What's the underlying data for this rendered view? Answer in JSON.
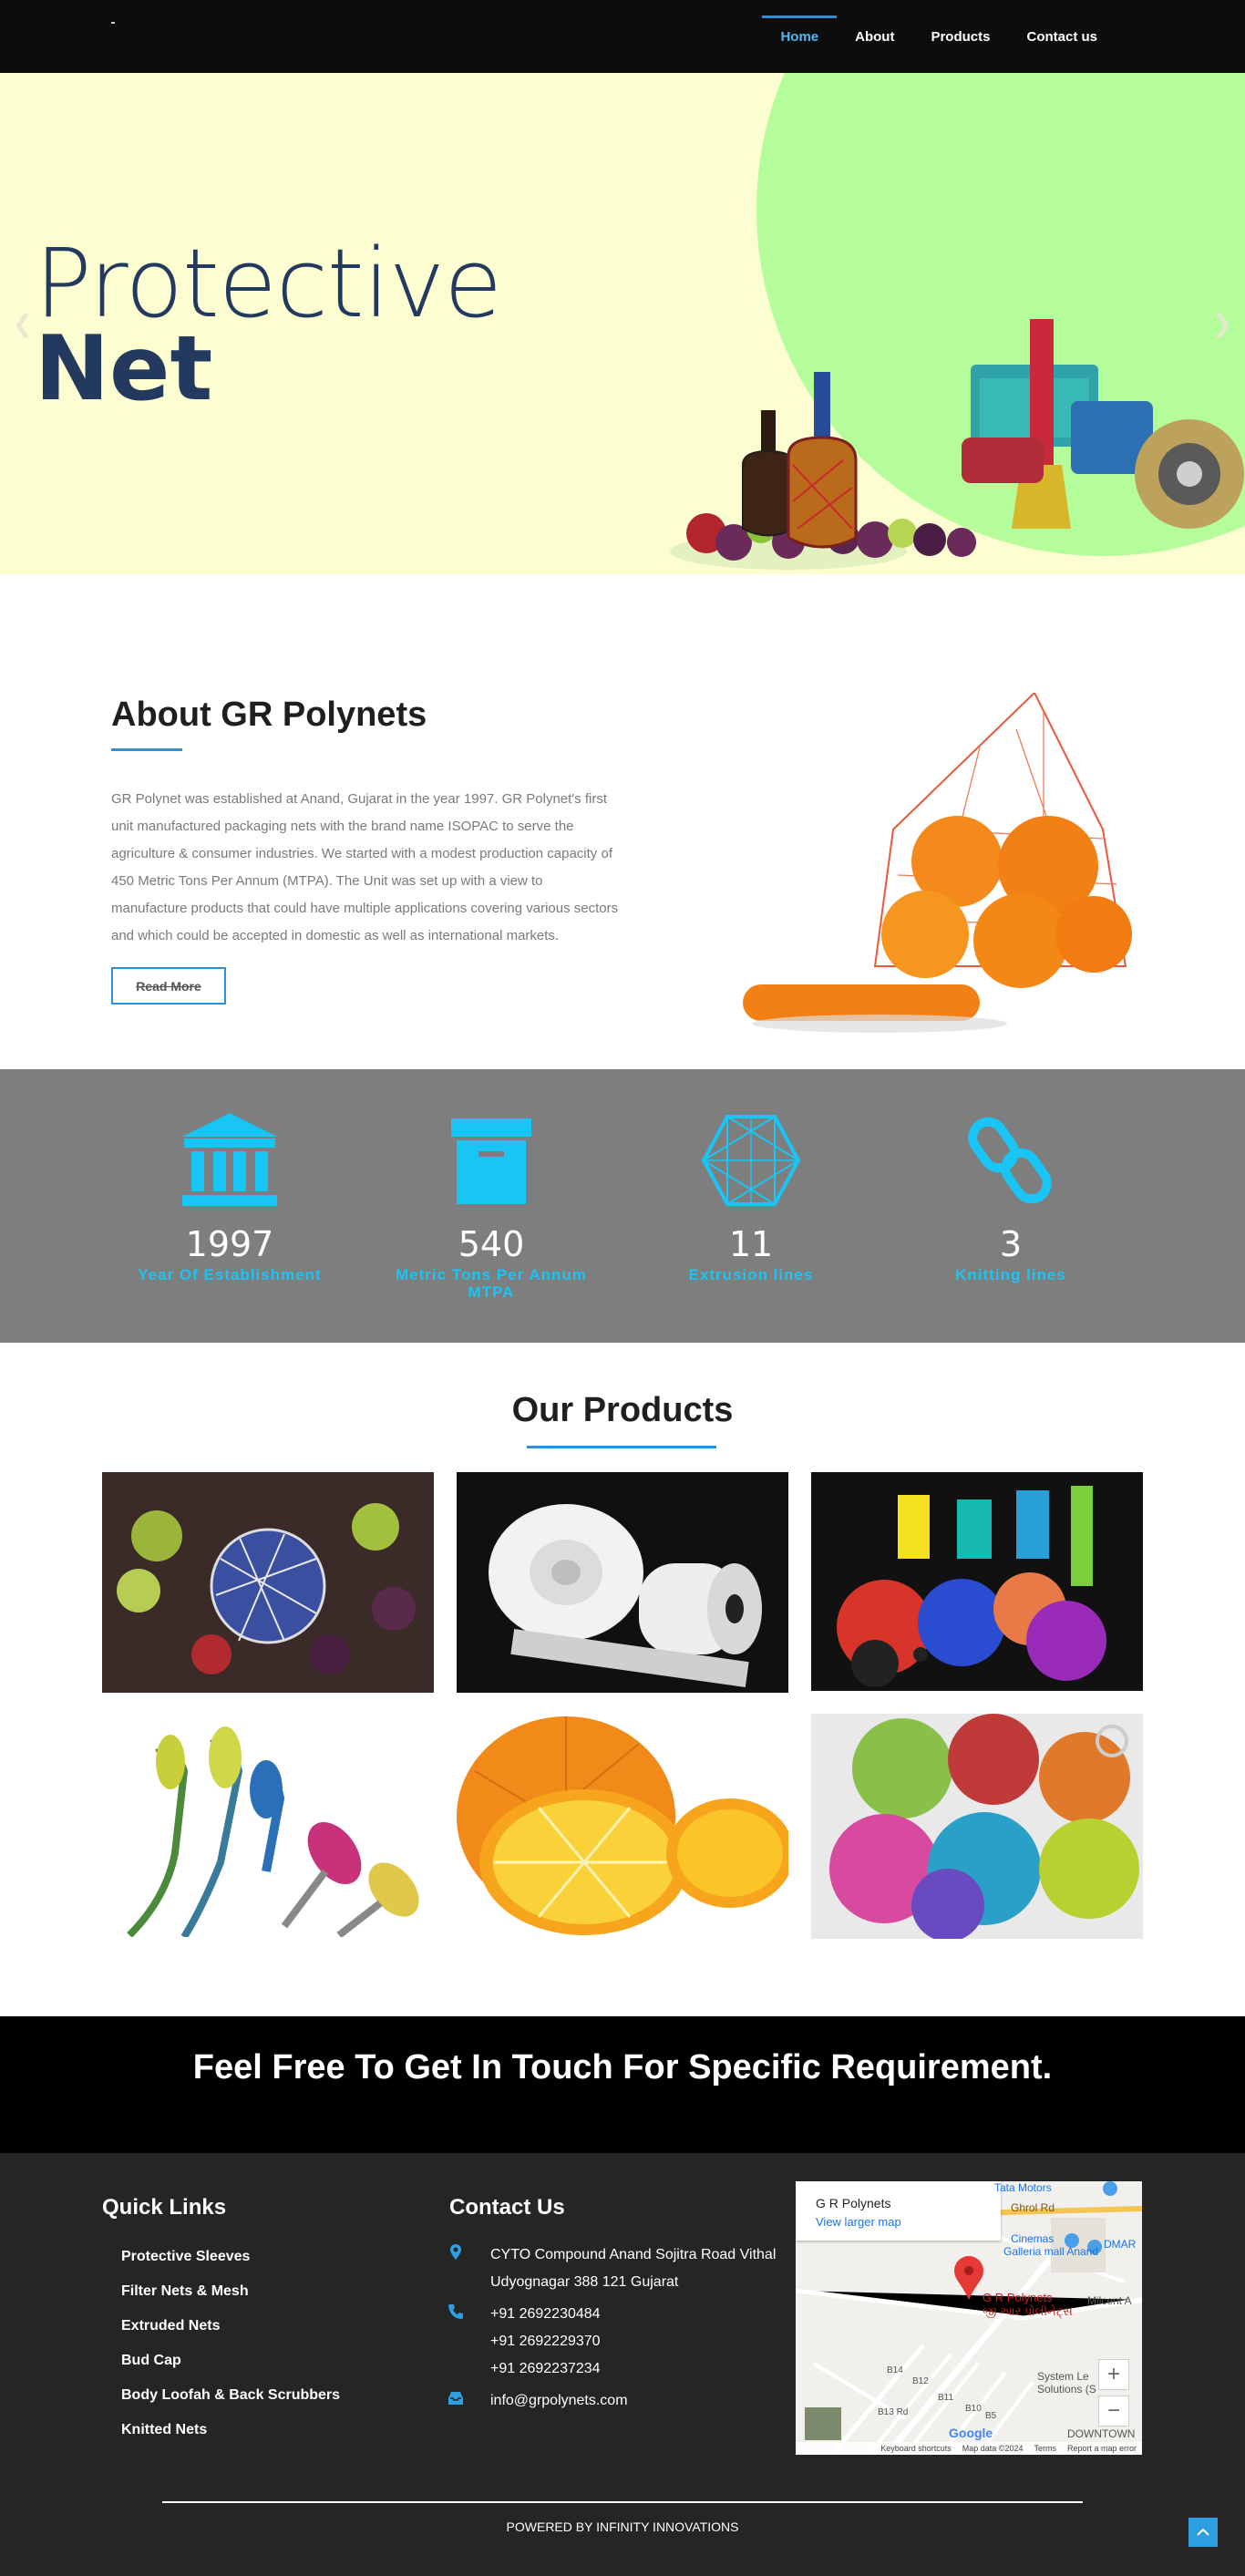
{
  "nav": {
    "brand": "",
    "items": [
      {
        "label": "Home",
        "active": true
      },
      {
        "label": "About"
      },
      {
        "label": "Products"
      },
      {
        "label": "Contact us"
      }
    ]
  },
  "hero": {
    "line1": "Protective",
    "line2": "Net",
    "prev_icon": "chevron-left-icon",
    "next_icon": "chevron-right-icon"
  },
  "about": {
    "heading": "About GR Polynets",
    "paragraph": "GR Polynet was established at Anand, Gujarat in the year 1997. GR Polynet's first unit manufactured packaging nets with the brand name ISOPAC to serve the agriculture & consumer industries. We started with a modest production capacity of 450 Metric Tons Per Annum (MTPA). The Unit was set up with a view to manufacture products that could have multiple applications covering various sectors and which could be accepted in domestic as well as international markets.",
    "button": "Read More"
  },
  "stats": [
    {
      "icon": "bank-icon",
      "value": "1997",
      "label": "Year Of Establishment"
    },
    {
      "icon": "archive-box-icon",
      "value": "540",
      "label": "Metric Tons Per Annum MTPA"
    },
    {
      "icon": "hexagon-mesh-icon",
      "value": "11",
      "label": "Extrusion lines"
    },
    {
      "icon": "chain-link-icon",
      "value": "3",
      "label": "Knitting lines"
    }
  ],
  "products": {
    "heading": "Our Products",
    "tiles": [
      "bottle-sleeve-image",
      "foam-roll-image",
      "knitted-net-toys-image",
      "flower-sleeve-image",
      "orange-image",
      "loofah-image"
    ]
  },
  "cta": {
    "text": "Feel Free To Get In Touch For Specific Requirement."
  },
  "footer": {
    "quick_links_heading": "Quick Links",
    "quick_links": [
      "Protective Sleeves",
      "Filter Nets & Mesh",
      "Extruded Nets",
      "Bud Cap",
      "Body Loofah & Back Scrubbers",
      "Knitted Nets"
    ],
    "contact_heading": "Contact Us",
    "address": [
      "CYTO Compound Anand Sojitra Road Vithal",
      "Udyognagar 388 121 Gujarat"
    ],
    "phones": [
      "+91 2692230484",
      "+91 2692229370",
      "+91 2692237234"
    ],
    "email": "info@grpolynets.com",
    "map": {
      "place": "G R Polynets",
      "place_local": "જી આર પોલીનેટ્સ",
      "larger_map": "View larger map",
      "road_1": "Ghrol Rd",
      "poi_1": "Tata Motors",
      "poi_2": "Cinemas",
      "poi_3": "Galleria mall Anand",
      "poi_4": "DMAR",
      "poi_5": "Milcent A",
      "poi_6": "System Le",
      "poi_7": "Solutions (S",
      "poi_8": "DOWNTOWN",
      "roads": [
        "B14",
        "B12",
        "B13 Rd",
        "B11",
        "B10",
        "B5"
      ],
      "attrib": [
        "Keyboard shortcuts",
        "Map data ©2024",
        "Terms",
        "Report a map error"
      ],
      "google": "Google"
    },
    "powered": "POWERED BY INFINITY INNOVATIONS"
  },
  "colors": {
    "accent": "#2d8fd8",
    "stat_label": "#18c5f4",
    "hero_bg": "#fcfed2",
    "hero_blob": "#b5fc9a",
    "heading": "#23395d"
  }
}
